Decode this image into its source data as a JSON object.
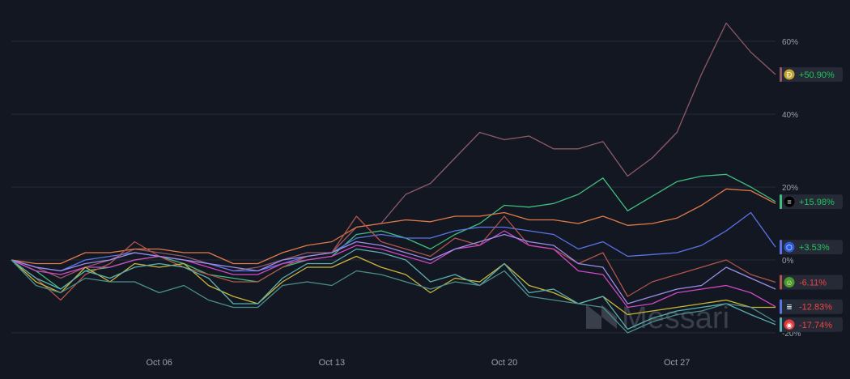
{
  "chart_data": {
    "type": "line",
    "watermark": "Messari",
    "x": [
      "Sep 30",
      "Oct 01",
      "Oct 02",
      "Oct 03",
      "Oct 04",
      "Oct 05",
      "Oct 06",
      "Oct 07",
      "Oct 08",
      "Oct 09",
      "Oct 10",
      "Oct 11",
      "Oct 12",
      "Oct 13",
      "Oct 14",
      "Oct 15",
      "Oct 16",
      "Oct 17",
      "Oct 18",
      "Oct 19",
      "Oct 20",
      "Oct 21",
      "Oct 22",
      "Oct 23",
      "Oct 24",
      "Oct 25",
      "Oct 26",
      "Oct 27",
      "Oct 28",
      "Oct 29",
      "Oct 30",
      "Oct 31"
    ],
    "x_tick_labels": [
      "Oct 06",
      "Oct 13",
      "Oct 20",
      "Oct 27"
    ],
    "y_ticks": [
      60,
      40,
      20,
      0,
      -20
    ],
    "y_tick_labels": [
      "60%",
      "40%",
      "20%",
      "0%",
      "-20%"
    ],
    "ylim": [
      -25,
      66
    ],
    "grid": true,
    "series": [
      {
        "color": "#8e5a66",
        "values": [
          0,
          -2,
          -5,
          -2,
          0,
          3,
          2,
          1,
          -1,
          -3,
          -2,
          0,
          2,
          2,
          9,
          10,
          18,
          21,
          28,
          35,
          33,
          34,
          30.5,
          30.5,
          32.5,
          23,
          28,
          35,
          51,
          65,
          57,
          50.9
        ]
      },
      {
        "color": "#3fbf7f",
        "values": [
          0,
          -3,
          -8,
          -3,
          -2,
          0,
          1,
          -1,
          -4,
          -5,
          -6,
          -2,
          0,
          1,
          7,
          8,
          6,
          3,
          7,
          10,
          15,
          14.5,
          15.5,
          18,
          22.5,
          13.5,
          17.5,
          21.5,
          23,
          23.5,
          20,
          15.98
        ]
      },
      {
        "color": "#e07a4a",
        "values": [
          0,
          -1,
          -1,
          2,
          2,
          3,
          3,
          2,
          2,
          -1,
          -1,
          2,
          4,
          5,
          9,
          10,
          11,
          10.5,
          12,
          12,
          13,
          11,
          11,
          10,
          12,
          9.5,
          10,
          11.5,
          15,
          19.5,
          19,
          15.5
        ]
      },
      {
        "color": "#5a74e8",
        "values": [
          0,
          -2,
          -3,
          0,
          1,
          2,
          1,
          0,
          -1,
          -3,
          -3,
          -1,
          1,
          2,
          6,
          7,
          6,
          6,
          8,
          9,
          9,
          8,
          7,
          3,
          5,
          1,
          1.5,
          2,
          4,
          8,
          13,
          3.53
        ]
      },
      {
        "color": "#b0554a",
        "values": [
          0,
          -5,
          -11,
          -4,
          -1,
          5,
          1,
          -2,
          -4,
          -6,
          -6,
          -2,
          1,
          2,
          12,
          5,
          3,
          1,
          6,
          4,
          12,
          4,
          3,
          -1,
          2,
          -10,
          -6,
          -4,
          -2,
          0,
          -4,
          -6.11
        ]
      },
      {
        "color": "#cf48c2",
        "values": [
          0,
          -3,
          -4,
          -2,
          -2,
          0,
          1,
          0,
          -2,
          -4,
          -4,
          -1,
          0,
          1,
          4,
          3,
          1,
          -1,
          3,
          4,
          8,
          4,
          3,
          -3,
          -4,
          -13,
          -12,
          -9,
          -8,
          -7,
          -9,
          -12.83
        ]
      },
      {
        "color": "#9b8de8",
        "values": [
          0,
          -2,
          -3,
          -1,
          0,
          2,
          1,
          0,
          -1,
          -2,
          -3,
          0,
          1,
          2,
          5,
          4,
          2,
          0,
          3,
          5,
          7,
          5,
          4,
          -1,
          -2,
          -12,
          -10,
          -8,
          -7,
          -2,
          -5,
          -8
        ]
      },
      {
        "color": "#c8b63a",
        "values": [
          0,
          -6,
          -9,
          -2,
          -6,
          -1,
          -2,
          -1,
          -7,
          -10,
          -12,
          -6,
          -2,
          -2,
          1,
          -2,
          -4,
          -9,
          -5,
          -6,
          -1,
          -7,
          -9,
          -12,
          -10,
          -15,
          -14,
          -13,
          -12,
          -11,
          -13,
          -13
        ]
      },
      {
        "color": "#5ab0b0",
        "values": [
          0,
          -5,
          -8,
          -3,
          -5,
          -2,
          -1,
          -2,
          -5,
          -12,
          -12,
          -5,
          -1,
          -1,
          3,
          2,
          0,
          -6,
          -4,
          -7,
          -1,
          -9,
          -8,
          -12,
          -10,
          -19,
          -16,
          -14,
          -13,
          -12,
          -15,
          -17.74
        ]
      },
      {
        "color": "#4b8f8c",
        "values": [
          0,
          -7,
          -9,
          -5,
          -6,
          -6,
          -9,
          -7,
          -11,
          -13,
          -13,
          -7,
          -6,
          -7,
          -3,
          -4,
          -6,
          -8,
          -6,
          -7,
          -3,
          -10,
          -11,
          -12,
          -13,
          -20,
          -17,
          -15,
          -14,
          -12,
          -13,
          -17
        ]
      }
    ],
    "legend_tags": [
      {
        "text": "+50.90%",
        "value": 50.9,
        "color": "#22c55e",
        "edge": "#8e5a66",
        "icon_bg": "#c2a633",
        "icon_text": "Ð"
      },
      {
        "text": "+15.98%",
        "value": 15.98,
        "color": "#22c55e",
        "edge": "#3fbf7f",
        "icon_bg": "#000000",
        "icon_text": "≡"
      },
      {
        "text": "+3.53%",
        "value": 3.53,
        "color": "#22c55e",
        "edge": "#5a74e8",
        "icon_bg": "#2a5ada",
        "icon_text": "⬡"
      },
      {
        "text": "-6.11%",
        "value": -6.11,
        "color": "#ef4444",
        "edge": "#b0554a",
        "icon_bg": "#4c9a2a",
        "icon_text": "☺"
      },
      {
        "text": "-12.83%",
        "value": -12.83,
        "color": "#ef4444",
        "edge": "#5a74e8",
        "icon_bg": "#1e2a3a",
        "icon_text": "≣"
      },
      {
        "text": "-17.74%",
        "value": -17.74,
        "color": "#ef4444",
        "edge": "#5ab0b0",
        "icon_bg": "#e23b3b",
        "icon_text": "◉"
      }
    ]
  }
}
